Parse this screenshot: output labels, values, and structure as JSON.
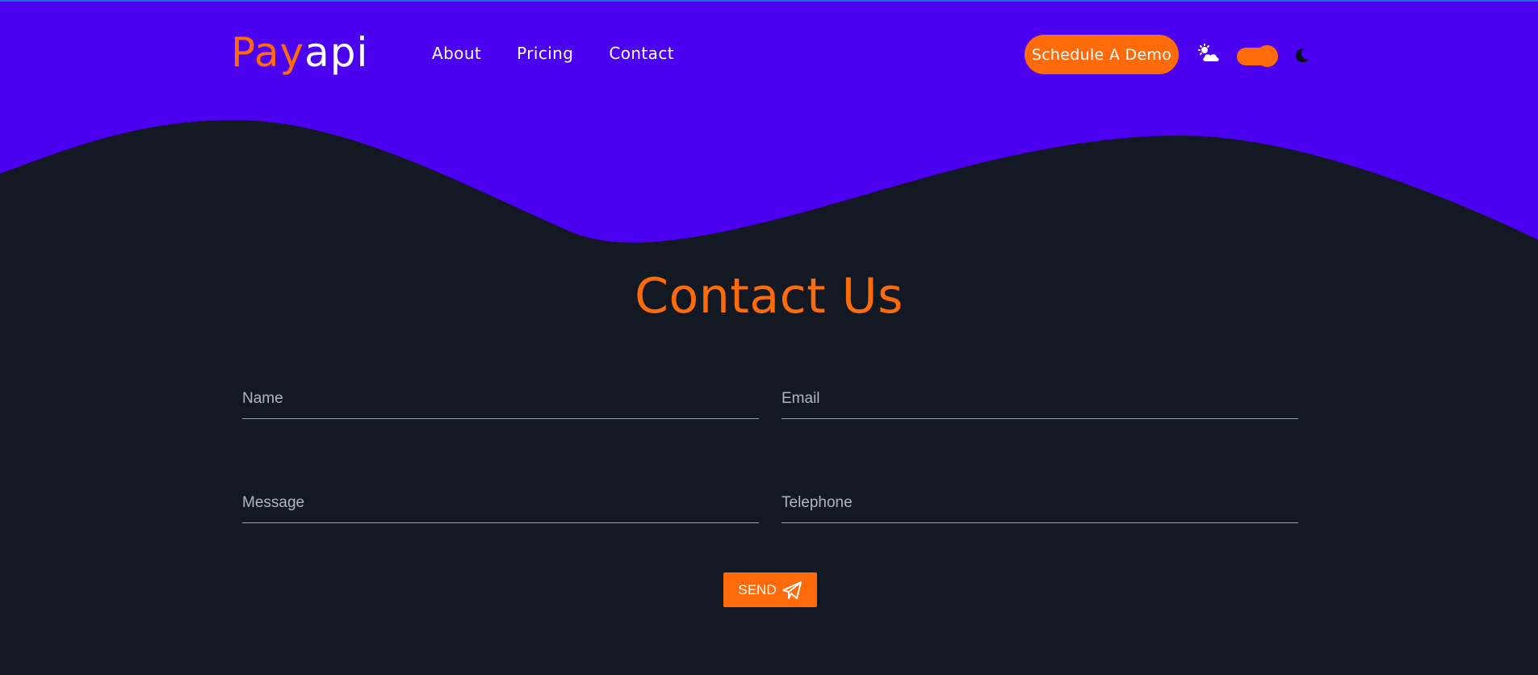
{
  "brand": {
    "logo_pay": "Pay",
    "logo_api": "api",
    "accent_color": "#ff6b0b",
    "header_color": "#4b00f0",
    "background_color": "#131922"
  },
  "nav": {
    "items": [
      {
        "label": "About"
      },
      {
        "label": "Pricing"
      },
      {
        "label": "Contact"
      }
    ]
  },
  "header_actions": {
    "demo_button": "Schedule A Demo",
    "weather_icon": "partly-cloudy-icon",
    "theme_toggle": "toggle",
    "theme_icon": "moon-icon"
  },
  "contact": {
    "title": "Contact Us",
    "fields": {
      "name": {
        "value": "",
        "placeholder": "Name"
      },
      "email": {
        "value": "",
        "placeholder": "Email"
      },
      "message": {
        "value": "",
        "placeholder": "Message"
      },
      "telephone": {
        "value": "",
        "placeholder": "Telephone"
      }
    },
    "send_label": "SEND",
    "send_icon": "paper-plane-icon"
  }
}
